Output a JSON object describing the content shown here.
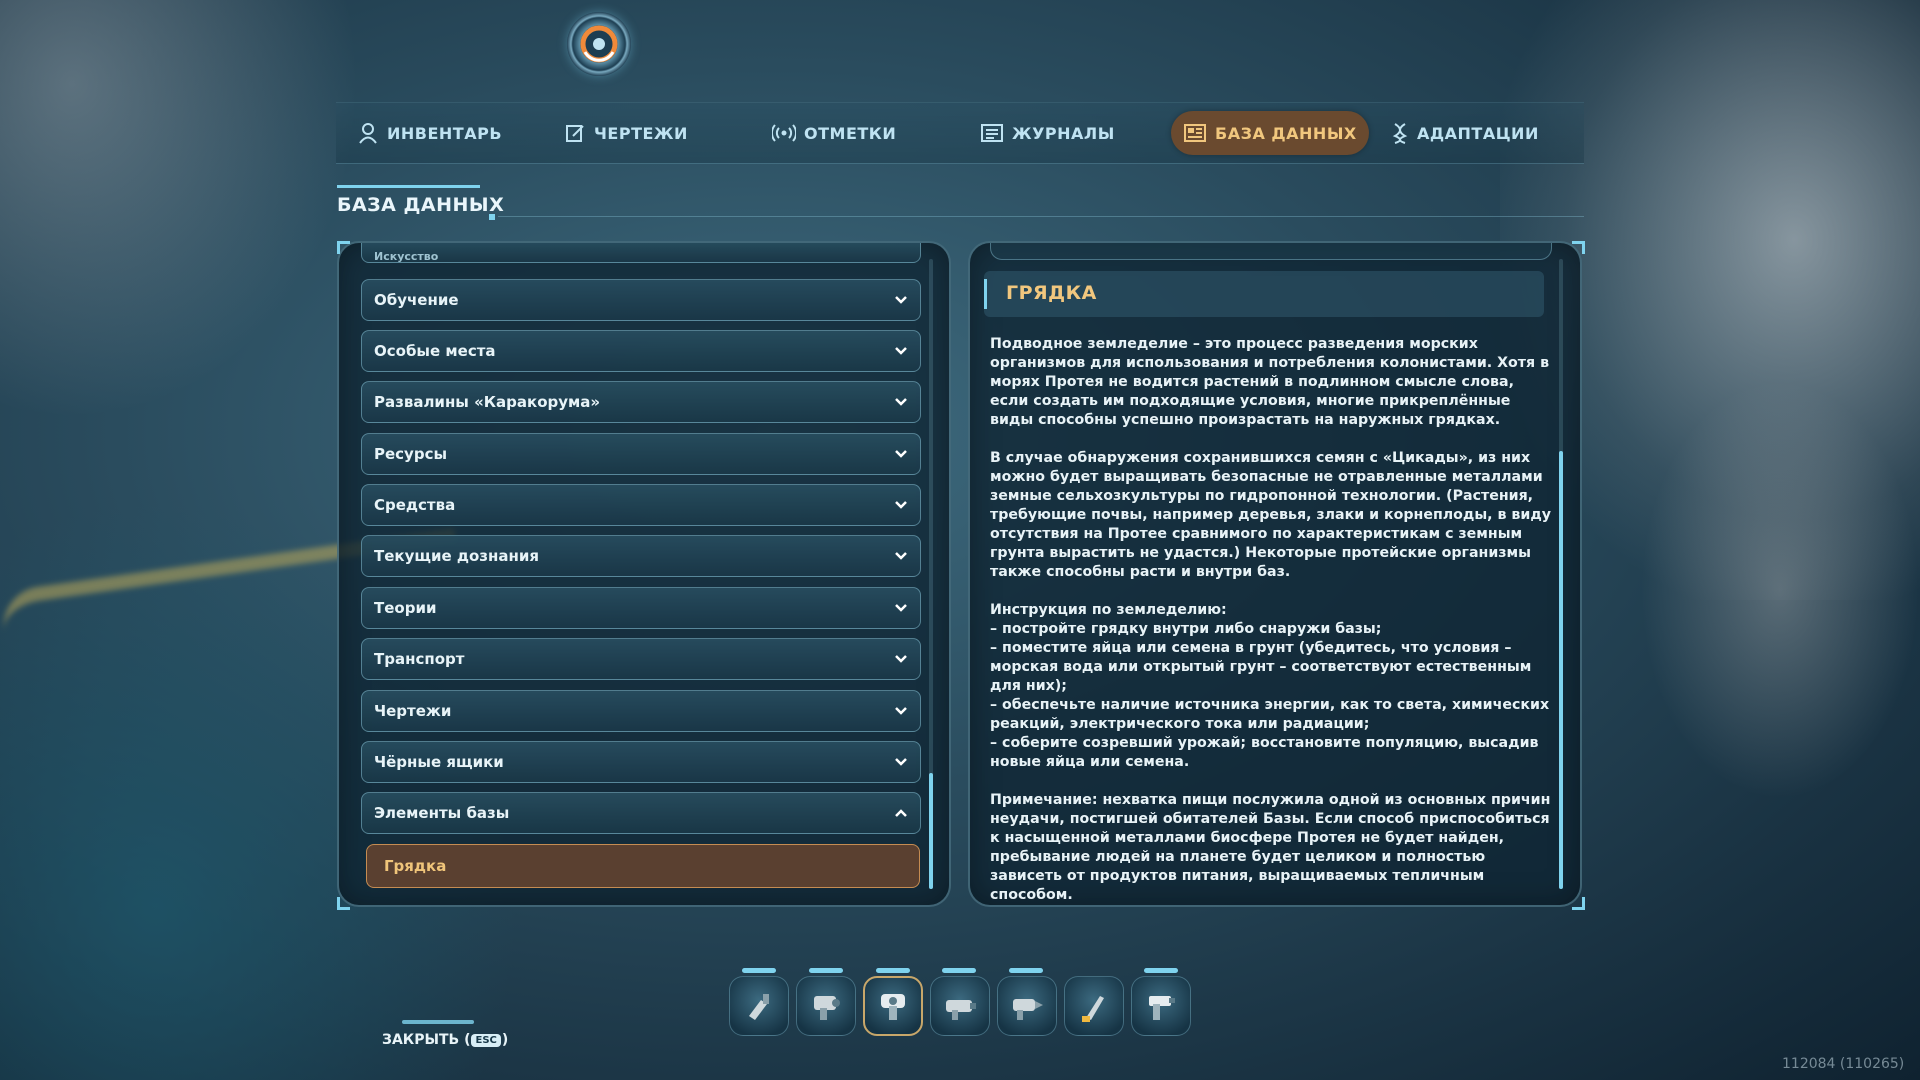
{
  "nav": {
    "tabs": [
      {
        "label": "ИНВЕНТАРЬ",
        "icon": "diver-icon"
      },
      {
        "label": "ЧЕРТЕЖИ",
        "icon": "blueprint-icon"
      },
      {
        "label": "ОТМЕТКИ",
        "icon": "signal-icon"
      },
      {
        "label": "ЖУРНАЛЫ",
        "icon": "log-icon"
      },
      {
        "label": "БАЗА ДАННЫХ",
        "icon": "database-icon",
        "active": true
      },
      {
        "label": "АДАПТАЦИИ",
        "icon": "dna-icon"
      }
    ]
  },
  "section_title": "БАЗА ДАННЫХ",
  "categories": {
    "partial_top": "Искусство",
    "items": [
      {
        "label": "Обучение",
        "expanded": false
      },
      {
        "label": "Особые места",
        "expanded": false
      },
      {
        "label": "Развалины «Каракорума»",
        "expanded": false
      },
      {
        "label": "Ресурсы",
        "expanded": false
      },
      {
        "label": "Средства",
        "expanded": false
      },
      {
        "label": "Текущие дознания",
        "expanded": false
      },
      {
        "label": "Теории",
        "expanded": false
      },
      {
        "label": "Транспорт",
        "expanded": false
      },
      {
        "label": "Чертежи",
        "expanded": false
      },
      {
        "label": "Чёрные ящики",
        "expanded": false
      },
      {
        "label": "Элементы базы",
        "expanded": true
      }
    ],
    "selected_entry": "Грядка"
  },
  "entry": {
    "title": "ГРЯДКА",
    "paragraphs": [
      "Подводное земледелие – это процесс разведения морских организмов для использования и потребления колонистами. Хотя в морях Протея не водится растений в подлинном смысле слова, если создать им подходящие условия, многие прикреплённые виды способны успешно произрастать на наружных грядках.",
      "В случае обнаружения сохранившихся семян с «Цикады», из них можно будет выращивать безопасные не отравленные металлами земные сельхозкультуры по гидропонной технологии. (Растения, требующие почвы, например деревья, злаки и корнеплоды, в виду отсутствия на Протее сравнимого по характеристикам с земным грунта вырастить не удастся.) Некоторые протейские организмы также способны расти и внутри баз.",
      "Инструкция по земледелию:\n– постройте грядку внутри либо снаружи базы;\n– поместите яйца или семена в грунт (убедитесь, что условия – морская вода или открытый грунт – соответствуют естественным для них);\n– обеспечьте наличие источника энергии, как то света, химических реакций, электрического тока или радиации;\n– соберите созревший урожай; восстановите популяцию, высадив новые яйца или семена.",
      "Примечание: нехватка пищи послужила одной из основных причин неудачи, постигшей обитателей Базы. Если способ приспособиться к насыщенной металлами биосфере Протея не будет найден, пребывание людей на планете будет целиком и полностью зависеть от продуктов питания, выращиваемых тепличным способом."
    ]
  },
  "toolbar": {
    "slots": [
      {
        "icon": "cutter-tool-icon"
      },
      {
        "icon": "scanner-tool-icon"
      },
      {
        "icon": "builder-tool-icon",
        "selected": true
      },
      {
        "icon": "repair-tool-icon"
      },
      {
        "icon": "drill-tool-icon"
      },
      {
        "icon": "knife-tool-icon"
      },
      {
        "icon": "gun-tool-icon"
      }
    ]
  },
  "close": {
    "prefix": "ЗАКРЫТЬ (",
    "key": "ESC",
    "suffix": ")"
  },
  "build_id": "112084 (110265)",
  "colors": {
    "accent": "#7fd3ee",
    "active_tab": "#6a4a2f",
    "active_text": "#f1c77e"
  }
}
